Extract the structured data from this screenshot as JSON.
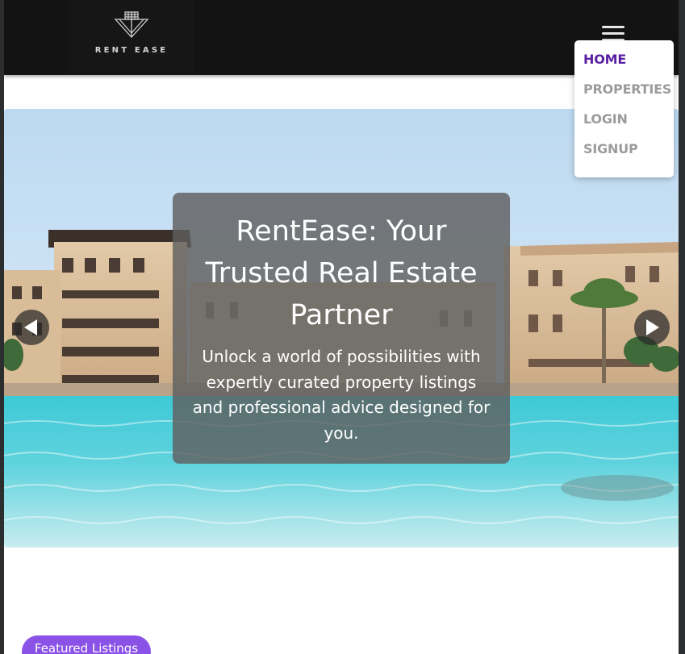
{
  "brand": {
    "name": "RENT EASE",
    "logo_icon": "building-logo-icon"
  },
  "nav": {
    "menu_icon": "hamburger-menu-icon",
    "items": [
      {
        "label": "HOME",
        "active": true
      },
      {
        "label": "PROPERTIES",
        "active": false
      },
      {
        "label": "LOGIN",
        "active": false
      },
      {
        "label": "SIGNUP",
        "active": false
      }
    ]
  },
  "hero": {
    "title": "RentEase: Your Trusted Real Estate Partner",
    "subtitle": "Unlock a world of possibilities with expertly curated property listings and professional advice designed for you.",
    "prev_icon": "arrow-left-icon",
    "next_icon": "arrow-right-icon"
  },
  "featured": {
    "label": "Featured Listings"
  },
  "colors": {
    "navbar": "#131313",
    "active_link": "#5a1fa3",
    "inactive_link": "#9b9b9b",
    "pill": "#8a52e6"
  }
}
